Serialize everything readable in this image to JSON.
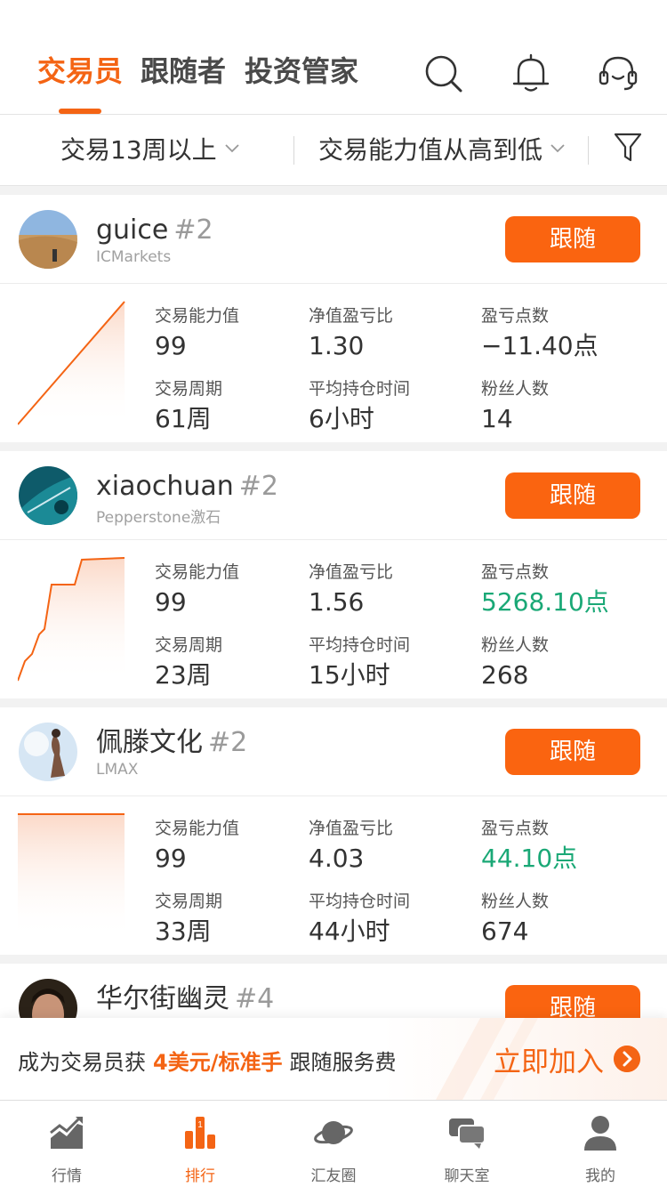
{
  "header": {
    "tabs": [
      {
        "label": "交易员",
        "active": true
      },
      {
        "label": "跟随者",
        "active": false
      },
      {
        "label": "投资管家",
        "active": false
      }
    ],
    "icons": [
      "search-icon",
      "bell-icon",
      "headset-icon"
    ],
    "accent_color": "#f46414"
  },
  "filters": {
    "period": "交易13周以上",
    "sort": "交易能力值从高到低",
    "filter_icon": "funnel-icon"
  },
  "traders": [
    {
      "name": "guice",
      "rank": "#2",
      "broker": "ICMarkets",
      "follow_label": "跟随",
      "stats": {
        "ability_label": "交易能力值",
        "ability": "99",
        "ratio_label": "净值盈亏比",
        "ratio": "1.30",
        "points_label": "盈亏点数",
        "points": "−11.40点",
        "period_label": "交易周期",
        "period": "61周",
        "hold_label": "平均持仓时间",
        "hold": "6小时",
        "fans_label": "粉丝人数",
        "fans": "14"
      }
    },
    {
      "name": "xiaochuan",
      "rank": "#2",
      "broker": "Pepperstone激石",
      "follow_label": "跟随",
      "stats": {
        "ability_label": "交易能力值",
        "ability": "99",
        "ratio_label": "净值盈亏比",
        "ratio": "1.56",
        "points_label": "盈亏点数",
        "points": "5268.10点",
        "period_label": "交易周期",
        "period": "23周",
        "hold_label": "平均持仓时间",
        "hold": "15小时",
        "fans_label": "粉丝人数",
        "fans": "268"
      }
    },
    {
      "name": "佩滕文化",
      "rank": "#2",
      "broker": "LMAX",
      "follow_label": "跟随",
      "stats": {
        "ability_label": "交易能力值",
        "ability": "99",
        "ratio_label": "净值盈亏比",
        "ratio": "4.03",
        "points_label": "盈亏点数",
        "points": "44.10点",
        "period_label": "交易周期",
        "period": "33周",
        "hold_label": "平均持仓时间",
        "hold": "44小时",
        "fans_label": "粉丝人数",
        "fans": "674"
      }
    },
    {
      "name": "华尔街幽灵",
      "rank": "#4",
      "follow_label": "跟随"
    }
  ],
  "promo": {
    "prefix": "成为交易员获",
    "highlight": "4美元/标准手",
    "suffix": "跟随服务费",
    "join_label": "立即加入"
  },
  "bottom_nav": [
    {
      "label": "行情",
      "icon": "chart-icon",
      "active": false
    },
    {
      "label": "排行",
      "icon": "ranking-icon",
      "active": true
    },
    {
      "label": "汇友圈",
      "icon": "planet-icon",
      "active": false
    },
    {
      "label": "聊天室",
      "icon": "chat-icon",
      "active": false
    },
    {
      "label": "我的",
      "icon": "user-icon",
      "active": false
    }
  ]
}
